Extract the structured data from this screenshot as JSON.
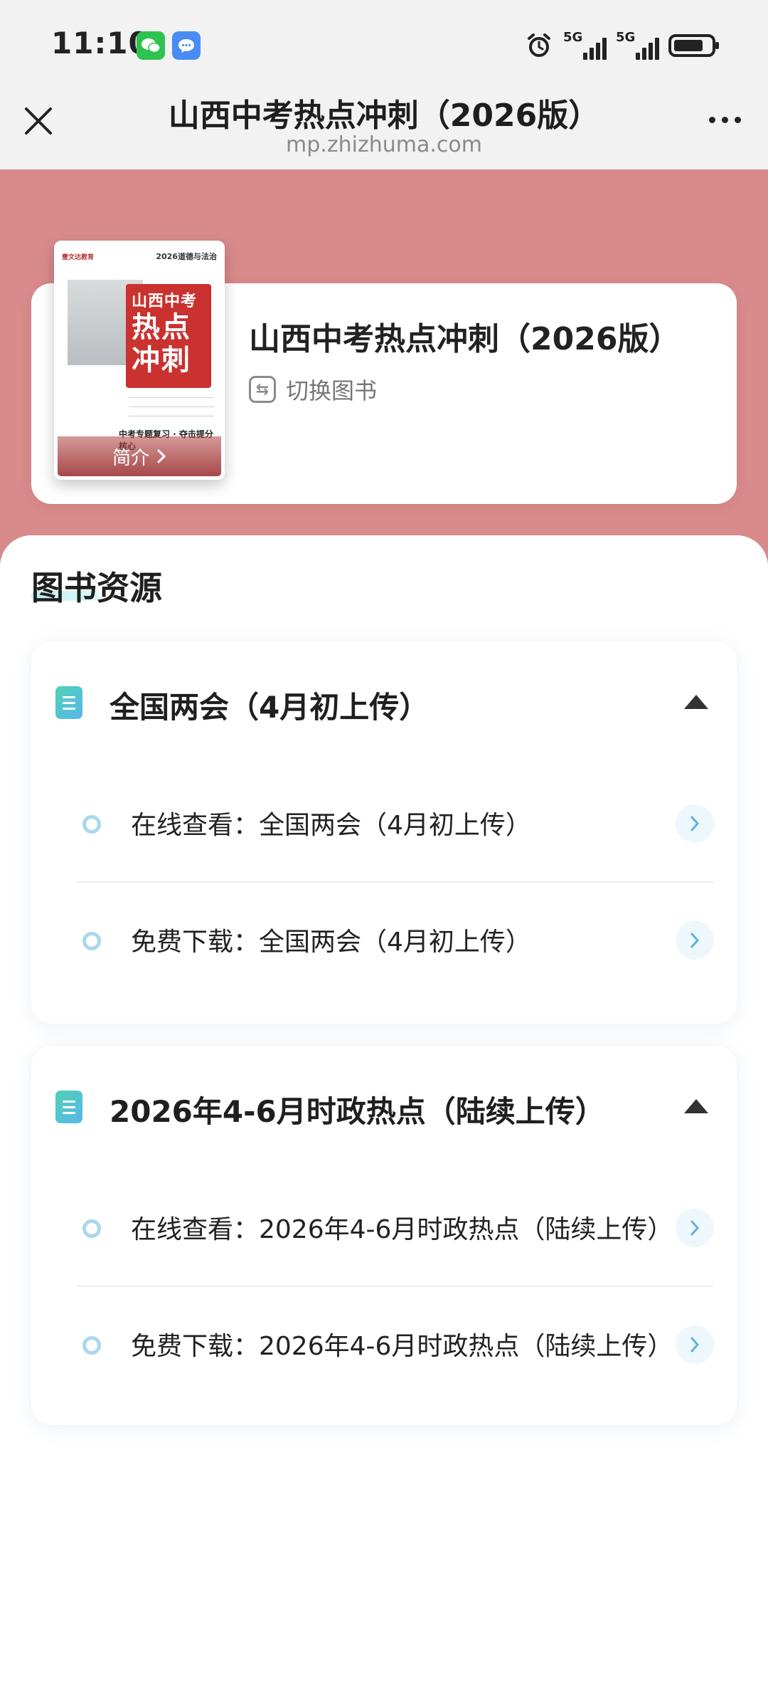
{
  "status_bar": {
    "time": "11:10",
    "network_1": "5G",
    "network_2": "5G",
    "icons": [
      "wechat-icon",
      "message-icon",
      "alarm-icon",
      "signal-icon",
      "battery-icon"
    ]
  },
  "nav": {
    "title": "山西中考热点冲刺（2026版）",
    "url": "mp.zhizhuma.com"
  },
  "book": {
    "title": "山西中考热点冲刺（2026版）",
    "switch_label": "切换图书",
    "cover": {
      "brand": "壹文达教育",
      "subject": "2026道德与法治",
      "title_line1": "山西中考",
      "title_line2": "热点",
      "title_line3": "冲刺",
      "slogan": "中考专题复习 · 夺击提分核心",
      "intro_label": "简介"
    }
  },
  "section": {
    "title": "图书资源"
  },
  "groups": [
    {
      "title": "全国两会（4月初上传）",
      "items": [
        {
          "label": "在线查看：全国两会（4月初上传）"
        },
        {
          "label": "免费下载：全国两会（4月初上传）"
        }
      ]
    },
    {
      "title": "2026年4-6月时政热点（陆续上传）",
      "items": [
        {
          "label": "在线查看：2026年4-6月时政热点（陆续上传）"
        },
        {
          "label": "免费下载：2026年4-6月时政热点（陆续上传）"
        }
      ]
    }
  ],
  "colors": {
    "hero_bg": "#d98b8b",
    "accent_teal": "#4fd1b5",
    "accent_blue": "#58b7ea",
    "cover_red": "#c9322f"
  }
}
